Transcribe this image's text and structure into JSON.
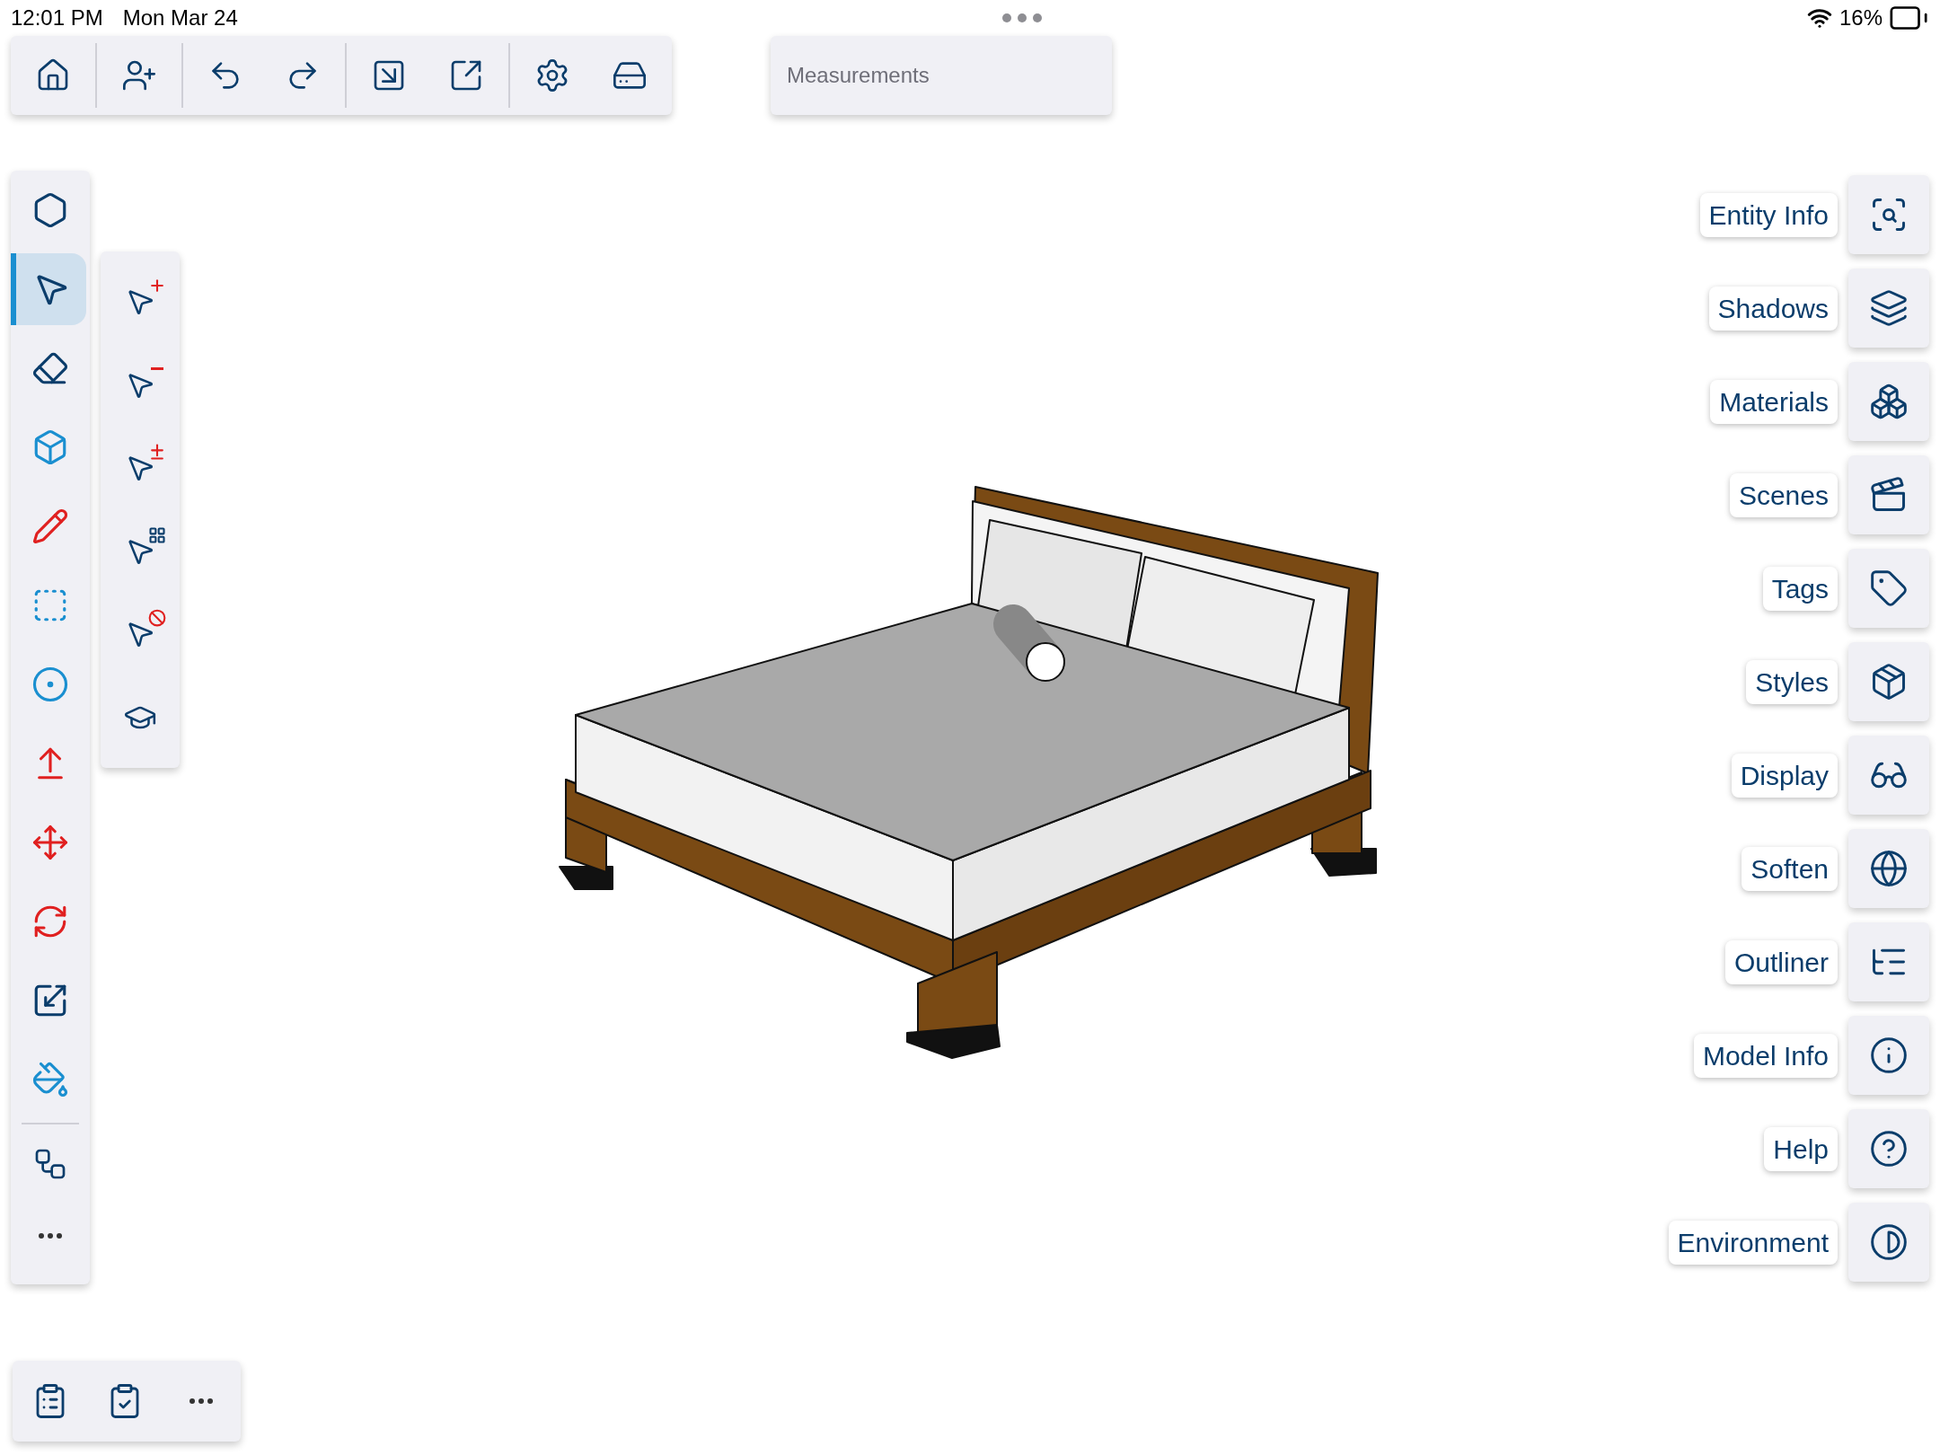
{
  "status_bar": {
    "time": "12:01 PM",
    "date": "Mon Mar 24",
    "battery": "16%"
  },
  "toolbar": {
    "measurements": {
      "placeholder": "Measurements"
    }
  },
  "tools": [
    {
      "selected": false
    },
    {
      "selected": true
    },
    {
      "selected": false
    },
    {
      "selected": false
    },
    {
      "selected": false
    },
    {
      "selected": false
    },
    {
      "selected": false
    },
    {
      "selected": false
    },
    {
      "selected": false
    },
    {
      "selected": false
    },
    {
      "selected": false
    },
    {
      "selected": false
    }
  ],
  "panels": [
    {
      "label": "Entity Info"
    },
    {
      "label": "Shadows"
    },
    {
      "label": "Materials"
    },
    {
      "label": "Scenes"
    },
    {
      "label": "Tags"
    },
    {
      "label": "Styles"
    },
    {
      "label": "Display"
    },
    {
      "label": "Soften"
    },
    {
      "label": "Outliner"
    },
    {
      "label": "Model Info"
    },
    {
      "label": "Help"
    },
    {
      "label": "Environment"
    }
  ]
}
